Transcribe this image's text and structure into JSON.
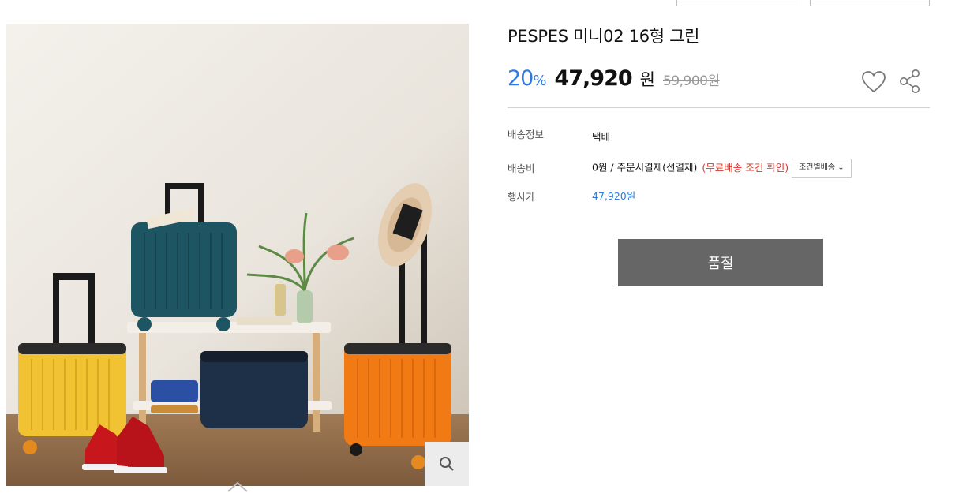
{
  "product": {
    "title": "PESPES 미니02 16형 그린",
    "discount_value": "20",
    "discount_unit": "%",
    "price": "47,920",
    "price_unit": "원",
    "original_price": "59,900원"
  },
  "info": {
    "shipping_info_label": "배송정보",
    "shipping_info_value": "택배",
    "shipping_fee_label": "배송비",
    "shipping_fee_value": "0원  / 주문시결제(선결제)",
    "shipping_fee_note": "(무료배송 조건 확인)",
    "shipping_condition_button": "조건별배송 ⌄",
    "event_price_label": "행사가",
    "event_price_value": "47,920원"
  },
  "actions": {
    "soldout_label": "품절"
  },
  "icons": {
    "wishlist": "heart-icon",
    "share": "share-icon",
    "zoom": "search-icon",
    "scroll": "chevron-up-icon"
  },
  "colors": {
    "discount": "#2a7be4",
    "note": "#d9342b",
    "soldout_bg": "#666666"
  }
}
